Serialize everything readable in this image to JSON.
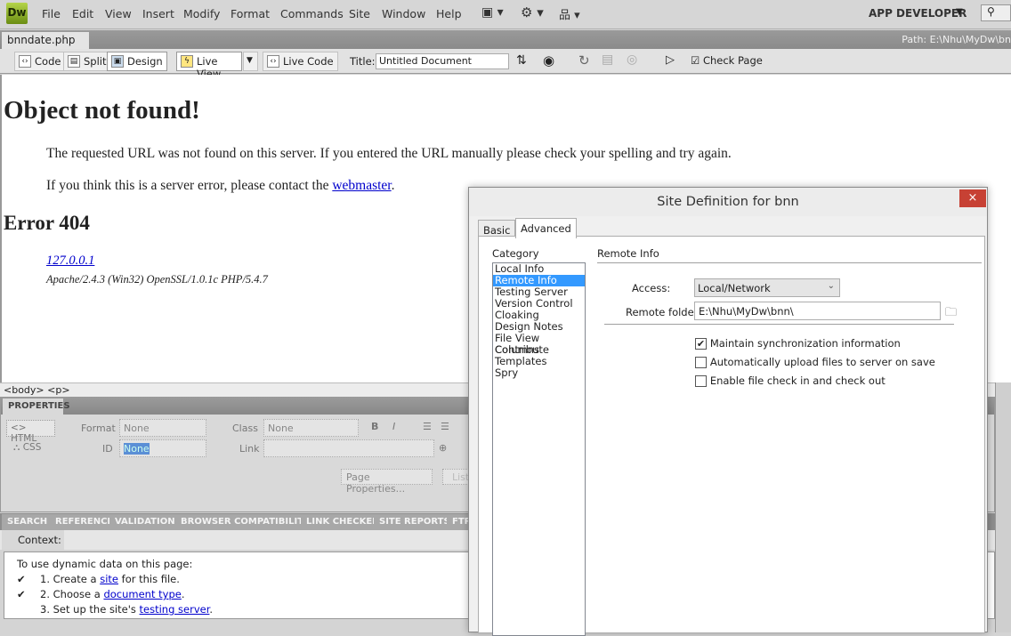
{
  "app": {
    "logo": "Dw",
    "workspace": "APP DEVELOPER",
    "menu": [
      "File",
      "Edit",
      "View",
      "Insert",
      "Modify",
      "Format",
      "Commands",
      "Site",
      "Window",
      "Help"
    ]
  },
  "document": {
    "tab": "bnndate.php",
    "close": "×",
    "path": "Path:  E:\\Nhu\\MyDw\\bn"
  },
  "toolbar": {
    "code": "Code",
    "split": "Split",
    "design": "Design",
    "live_view": "Live View",
    "live_code": "Live Code",
    "title_label": "Title:",
    "title_value": "Untitled Document",
    "check_page": "Check Page"
  },
  "page": {
    "h1": "Object not found!",
    "p1": "The requested URL was not found on this server. If you entered the URL manually please check your spelling and try again.",
    "p2_pre": "If you think this is a server error, please contact the ",
    "p2_link": "webmaster",
    "p2_post": ".",
    "h2": "Error 404",
    "host": "127.0.0.1",
    "server": "Apache/2.4.3 (Win32) OpenSSL/1.0.1c PHP/5.4.7"
  },
  "tag_selector": "<body> <p>",
  "properties": {
    "header": "PROPERTIES",
    "html": "HTML",
    "css": "CSS",
    "format_label": "Format",
    "format_value": "None",
    "class_label": "Class",
    "class_value": "None",
    "id_label": "ID",
    "id_value": "None",
    "link_label": "Link",
    "link_value": "",
    "page_properties": "Page Properties...",
    "list_item": "List"
  },
  "results": {
    "tabs": [
      "SEARCH",
      "REFERENCE",
      "VALIDATION",
      "BROWSER COMPATIBILITY",
      "LINK CHECKER",
      "SITE REPORTS",
      "FTP"
    ],
    "context_label": "Context:",
    "intro": "To use dynamic data on this page:",
    "steps": [
      {
        "pre": "1.  Create a ",
        "link": "site",
        "post": " for this file.",
        "done": true
      },
      {
        "pre": "2.  Choose a ",
        "link": "document type",
        "post": ".",
        "done": true
      },
      {
        "pre": "3.  Set up the site's ",
        "link": "testing server",
        "post": ".",
        "done": false
      }
    ]
  },
  "dialog": {
    "title": "Site Definition for bnn",
    "close": "×",
    "tabs": [
      "Basic",
      "Advanced"
    ],
    "active_tab": "Advanced",
    "category_label": "Category",
    "categories": [
      "Local Info",
      "Remote Info",
      "Testing Server",
      "Version Control",
      "Cloaking",
      "Design Notes",
      "File View Columns",
      "Contribute",
      "Templates",
      "Spry"
    ],
    "selected_category": "Remote Info",
    "section_title": "Remote Info",
    "access_label": "Access:",
    "access_value": "Local/Network",
    "remote_folder_label": "Remote folder:",
    "remote_folder_value": "E:\\Nhu\\MyDw\\bnn\\",
    "options": [
      {
        "label": "Maintain synchronization information",
        "checked": true
      },
      {
        "label": "Automatically upload files to server on save",
        "checked": false
      },
      {
        "label": "Enable file check in and check out",
        "checked": false
      }
    ]
  }
}
